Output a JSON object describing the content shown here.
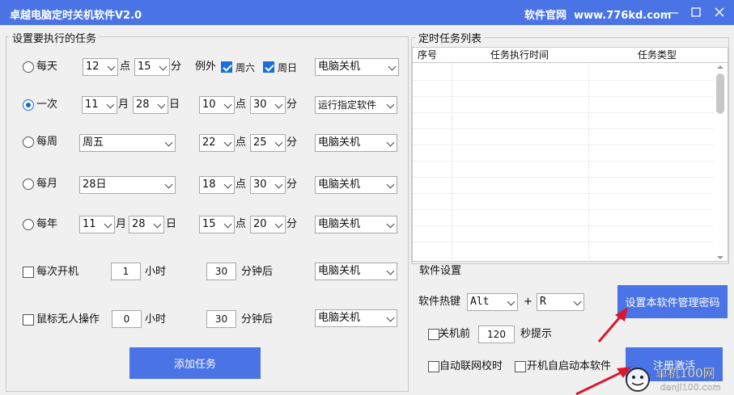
{
  "window": {
    "title": "卓越电脑定时关机软件V2.0",
    "site_label": "软件官网",
    "site_url": "www.776kd.com"
  },
  "task_group": {
    "legend": "设置要执行的任务",
    "rows": {
      "daily": {
        "label": "每天",
        "hour": "12",
        "hour_unit": "点",
        "minute": "15",
        "minute_unit": "分",
        "except_label": "例外",
        "sat_label": "周六",
        "sun_label": "周日",
        "action": "电脑关机"
      },
      "once": {
        "label": "一次",
        "month": "11",
        "month_unit": "月",
        "day": "28",
        "day_unit": "日",
        "hour": "10",
        "hour_unit": "点",
        "minute": "30",
        "minute_unit": "分",
        "action": "运行指定软件"
      },
      "weekly": {
        "label": "每周",
        "weekday": "周五",
        "hour": "22",
        "hour_unit": "点",
        "minute": "25",
        "minute_unit": "分",
        "action": "电脑关机"
      },
      "monthly": {
        "label": "每月",
        "day": "28日",
        "hour": "18",
        "hour_unit": "点",
        "minute": "30",
        "minute_unit": "分",
        "action": "电脑关机"
      },
      "yearly": {
        "label": "每年",
        "month": "11",
        "month_unit": "月",
        "day": "28",
        "day_unit": "日",
        "hour": "15",
        "hour_unit": "点",
        "minute": "20",
        "minute_unit": "分",
        "action": "电脑关机"
      },
      "boot": {
        "label": "每次开机",
        "hours": "1",
        "hours_unit": "小时",
        "minutes": "30",
        "minutes_unit": "分钟后",
        "action": "电脑关机"
      },
      "idle": {
        "label": "鼠标无人操作",
        "hours": "0",
        "hours_unit": "小时",
        "minutes": "30",
        "minutes_unit": "分钟后",
        "action": "电脑关机"
      }
    },
    "add_button": "添加任务"
  },
  "task_list": {
    "legend": "定时任务列表",
    "columns": [
      "序号",
      "任务执行时间",
      "任务类型"
    ]
  },
  "settings": {
    "legend": "软件设置",
    "hotkey_label": "软件热键",
    "hotkey_mod": "Alt",
    "plus": "+",
    "hotkey_key": "R",
    "set_password_button": "设置本软件管理密码",
    "before_shutdown_label": "关机前",
    "before_shutdown_seconds": "120",
    "seconds_hint": "秒提示",
    "auto_time_sync_label": "自动联网校时",
    "autostart_label": "开机自启动本软件",
    "register_button": "注册激活"
  },
  "colors": {
    "accent": "#4a74e5",
    "arrow": "#d9182d"
  }
}
